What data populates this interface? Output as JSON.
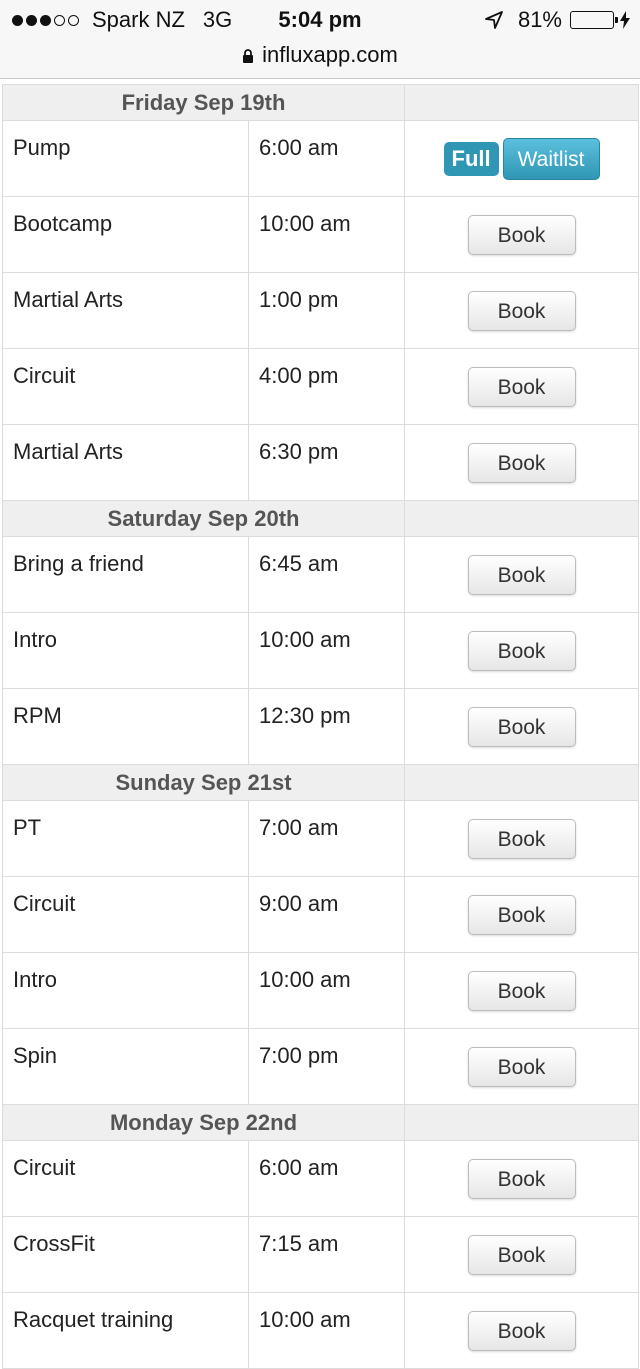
{
  "status_bar": {
    "signal_bars_filled": 3,
    "signal_bars_total": 5,
    "carrier": "Spark NZ",
    "network": "3G",
    "time": "5:04 pm",
    "battery_percent_text": "81%",
    "battery_level": 0.81,
    "icons": [
      "location-arrow-icon",
      "battery-icon",
      "charging-bolt-icon"
    ]
  },
  "url_bar": {
    "url": "influxapp.com",
    "icon": "lock-icon"
  },
  "colors": {
    "accent": "#2f96b4",
    "waitlist": "#5bc0de",
    "battery": "#4cd964",
    "day_header_bg": "#efefef"
  },
  "labels": {
    "book": "Book",
    "full": "Full",
    "waitlist": "Waitlist"
  },
  "days": [
    {
      "title": "Friday Sep 19th",
      "classes": [
        {
          "name": "Pump",
          "time": "6:00 am",
          "status": "full"
        },
        {
          "name": "Bootcamp",
          "time": "10:00 am",
          "status": "book"
        },
        {
          "name": "Martial Arts",
          "time": "1:00 pm",
          "status": "book"
        },
        {
          "name": "Circuit",
          "time": "4:00 pm",
          "status": "book"
        },
        {
          "name": "Martial Arts",
          "time": "6:30 pm",
          "status": "book"
        }
      ]
    },
    {
      "title": "Saturday Sep 20th",
      "classes": [
        {
          "name": "Bring a friend",
          "time": "6:45 am",
          "status": "book"
        },
        {
          "name": "Intro",
          "time": "10:00 am",
          "status": "book"
        },
        {
          "name": "RPM",
          "time": "12:30 pm",
          "status": "book"
        }
      ]
    },
    {
      "title": "Sunday Sep 21st",
      "classes": [
        {
          "name": "PT",
          "time": "7:00 am",
          "status": "book"
        },
        {
          "name": "Circuit",
          "time": "9:00 am",
          "status": "book"
        },
        {
          "name": "Intro",
          "time": "10:00 am",
          "status": "book"
        },
        {
          "name": "Spin",
          "time": "7:00 pm",
          "status": "book"
        }
      ]
    },
    {
      "title": "Monday Sep 22nd",
      "classes": [
        {
          "name": "Circuit",
          "time": "6:00 am",
          "status": "book"
        },
        {
          "name": "CrossFit",
          "time": "7:15 am",
          "status": "book"
        },
        {
          "name": "Racquet training",
          "time": "10:00 am",
          "status": "book"
        }
      ]
    }
  ]
}
